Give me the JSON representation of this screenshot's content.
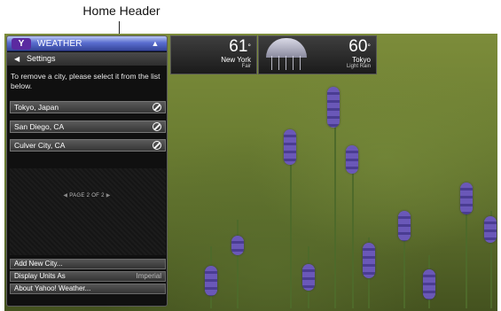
{
  "callout": {
    "label": "Home Header"
  },
  "tiles": [
    {
      "temp": "61",
      "deg": "°",
      "city": "New York",
      "condition": "Fair"
    },
    {
      "temp": "60",
      "deg": "°",
      "city": "Tokyo",
      "condition": "Light Rain"
    }
  ],
  "header": {
    "logo": "Y",
    "title": "WEATHER",
    "home_icon": "home-icon"
  },
  "settings": {
    "back_icon": "back-arrow-icon",
    "label": "Settings"
  },
  "instruction": "To remove a city, please select it from the list below.",
  "cities": [
    {
      "label": "Tokyo, Japan"
    },
    {
      "label": "San Diego, CA"
    },
    {
      "label": "Culver City, CA"
    }
  ],
  "pager": {
    "label": "PAGE 2 OF 2",
    "prev": "◀",
    "next": "▶"
  },
  "menu": [
    {
      "label": "Add New City...",
      "value": ""
    },
    {
      "label": "Display Units As",
      "value": "Imperial"
    },
    {
      "label": "About Yahoo! Weather...",
      "value": ""
    }
  ],
  "colors": {
    "header_blue": "#36469a",
    "yahoo_purple": "#5b2aa0",
    "panel_bg": "#101010"
  }
}
